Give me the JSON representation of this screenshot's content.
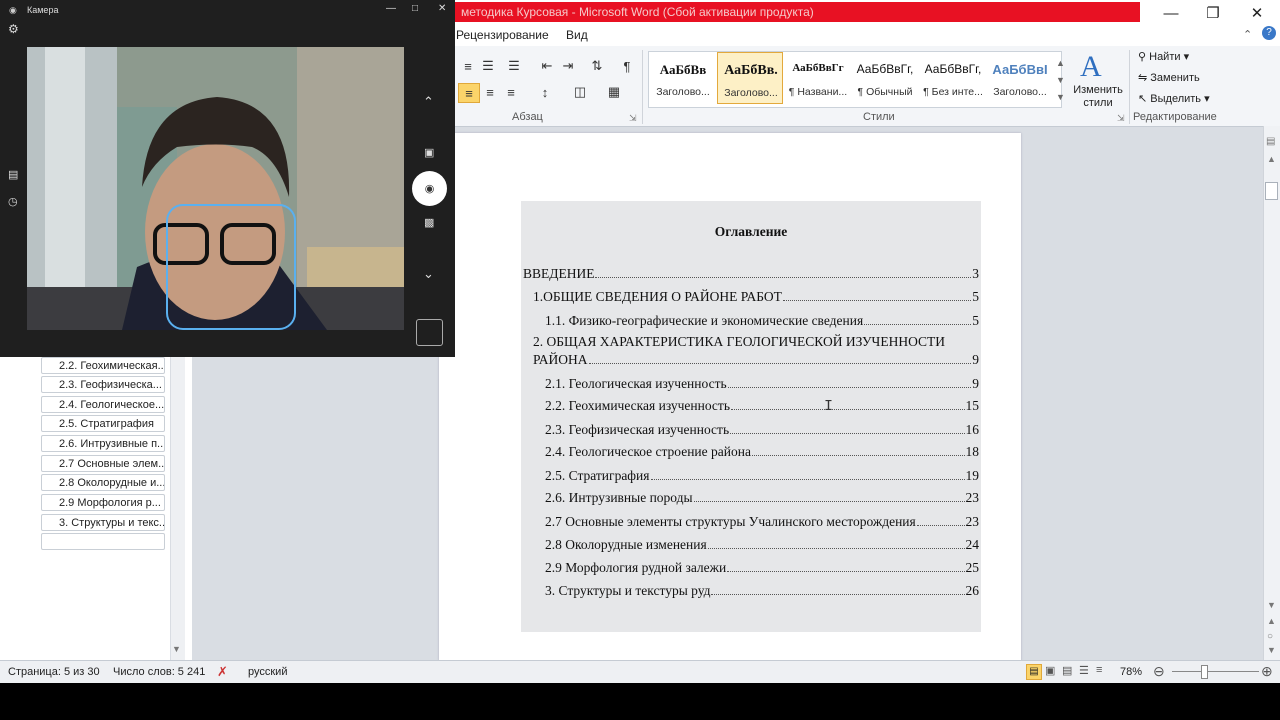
{
  "word": {
    "title": "методика Курсовая - Microsoft Word (Сбой активации продукта)",
    "tabs": [
      "Рецензирование",
      "Вид"
    ],
    "paragraph_group_label": "Абзац",
    "styles_group_label": "Стили",
    "editing_group_label": "Редактирование",
    "change_styles_label": "Изменить стили",
    "editing": {
      "find": "Найти",
      "replace": "Заменить",
      "select": "Выделить"
    },
    "styles": [
      {
        "sample": "АаБбВв",
        "name": "Заголово..."
      },
      {
        "sample": "АаБбВв.",
        "name": "Заголово..."
      },
      {
        "sample": "АаБбВвГг",
        "name": "¶ Названи..."
      },
      {
        "sample": "АаБбВвГг,",
        "name": "¶ Обычный"
      },
      {
        "sample": "АаБбВвГг,",
        "name": "¶ Без инте..."
      },
      {
        "sample": "АаБбВвI",
        "name": "Заголово..."
      }
    ]
  },
  "nav_items": [
    "2.2. Геохимическая...",
    "2.3. Геофизическа...",
    "2.4. Геологическое...",
    "2.5. Стратиграфия",
    "2.6. Интрузивные п...",
    "2.7 Основные элем...",
    "2.8 Околорудные и...",
    "2.9 Морфология р...",
    "3. Структуры и текс..."
  ],
  "document": {
    "toc_title": "Оглавление",
    "toc": [
      {
        "text": "ВВЕДЕНИЕ",
        "page": "3"
      },
      {
        "text": "1.ОБЩИЕ СВЕДЕНИЯ О РАЙОНЕ РАБОТ",
        "page": "5"
      },
      {
        "text": "1.1. Физико-географические и экономические сведения",
        "page": "5"
      },
      {
        "text": "2. ОБЩАЯ ХАРАКТЕРИСТИКА ГЕОЛОГИЧЕСКОЙ ИЗУЧЕННОСТИ",
        "text2": "РАЙОНА",
        "page": "9"
      },
      {
        "text": "2.1. Геологическая изученность",
        "page": "9"
      },
      {
        "text": "2.2. Геохимическая изученность",
        "page": "15"
      },
      {
        "text": "2.3. Геофизическая изученность",
        "page": "16"
      },
      {
        "text": "2.4. Геологическое строение района",
        "page": "18"
      },
      {
        "text": "2.5. Стратиграфия",
        "page": "19"
      },
      {
        "text": "2.6. Интрузивные породы",
        "page": "23"
      },
      {
        "text": "2.7 Основные элементы структуры Учалинского месторождения",
        "page": "23"
      },
      {
        "text": "2.8 Околорудные изменения",
        "page": "24"
      },
      {
        "text": "2.9 Морфология рудной залежи",
        "page": "25"
      },
      {
        "text": "3. Структуры и текстуры руд",
        "page": "26"
      }
    ]
  },
  "status": {
    "page": "Страница: 5 из 30",
    "words": "Число слов: 5 241",
    "language": "русский",
    "zoom": "78%"
  },
  "camera": {
    "title": "Камера"
  }
}
